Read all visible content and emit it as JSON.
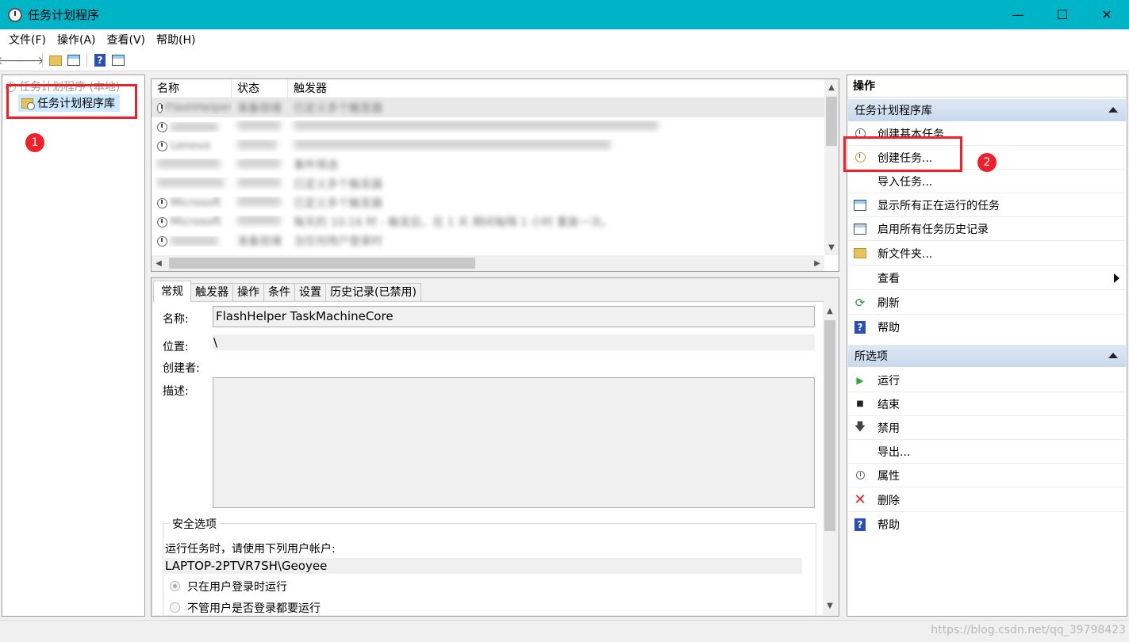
{
  "window": {
    "title": "任务计划程序",
    "minimize": "—",
    "maximize": "☐",
    "close": "✕"
  },
  "menu": [
    "文件(F)",
    "操作(A)",
    "查看(V)",
    "帮助(H)"
  ],
  "tree": {
    "root_label": "任务计划程序 (本地)",
    "library_label": "任务计划程序库"
  },
  "annotations": {
    "badge1": "1",
    "badge2": "2"
  },
  "task_list": {
    "columns": [
      "名称",
      "状态",
      "触发器"
    ],
    "rows": [
      {
        "name": "FlashHelper",
        "status": "准备就绪",
        "trigger": "已定义多个触发器"
      },
      {
        "name": "",
        "status": "",
        "trigger": ""
      },
      {
        "name": "Lenovo",
        "status": "",
        "trigger": ""
      },
      {
        "name": "",
        "status": "",
        "trigger": "事件筛选"
      },
      {
        "name": "",
        "status": "",
        "trigger": "已定义多个触发器"
      },
      {
        "name": "Microsoft",
        "status": "",
        "trigger": "已定义多个触发器"
      },
      {
        "name": "Microsoft",
        "status": "",
        "trigger": "每天的 10:16 时 - 触发后，在 1 天 期间每隔 1 小时 重复一次。"
      },
      {
        "name": "",
        "status": "准备就绪",
        "trigger": "当任何用户登录时"
      }
    ]
  },
  "details": {
    "tabs": [
      "常规",
      "触发器",
      "操作",
      "条件",
      "设置",
      "历史记录(已禁用)"
    ],
    "labels": {
      "name": "名称:",
      "location": "位置:",
      "author": "创建者:",
      "description": "描述:"
    },
    "values": {
      "name": "FlashHelper TaskMachineCore",
      "location": "\\",
      "author": "",
      "description": ""
    },
    "security": {
      "title": "安全选项",
      "run_as_text": "运行任务时，请使用下列用户帐户:",
      "account": "LAPTOP-2PTVR7SH\\Geoyee",
      "option_logged_on": "只在用户登录时运行",
      "option_any": "不管用户是否登录都要运行"
    }
  },
  "actions": {
    "header": "操作",
    "library_section": "任务计划程序库",
    "library_items": [
      {
        "label": "创建基本任务...",
        "icon": "create-basic-task-icon"
      },
      {
        "label": "创建任务...",
        "icon": "create-task-icon"
      },
      {
        "label": "导入任务...",
        "icon": "none"
      },
      {
        "label": "显示所有正在运行的任务",
        "icon": "running-tasks-icon"
      },
      {
        "label": "启用所有任务历史记录",
        "icon": "history-icon"
      },
      {
        "label": "新文件夹...",
        "icon": "folder-icon"
      },
      {
        "label": "查看",
        "icon": "none"
      },
      {
        "label": "刷新",
        "icon": "refresh-icon"
      },
      {
        "label": "帮助",
        "icon": "help-icon"
      }
    ],
    "selected_section": "所选项",
    "selected_items": [
      {
        "label": "运行",
        "icon": "run-icon"
      },
      {
        "label": "结束",
        "icon": "stop-icon"
      },
      {
        "label": "禁用",
        "icon": "disable-icon"
      },
      {
        "label": "导出...",
        "icon": "none"
      },
      {
        "label": "属性",
        "icon": "properties-icon"
      },
      {
        "label": "删除",
        "icon": "delete-icon"
      },
      {
        "label": "帮助",
        "icon": "help-icon"
      }
    ]
  },
  "watermark": "https://blog.csdn.net/qq_39798423",
  "colors": {
    "titlebar": "#00b4c8",
    "annotation": "#f0202a",
    "section_header": "#c8d9ec",
    "selection": "#cde8ff"
  }
}
